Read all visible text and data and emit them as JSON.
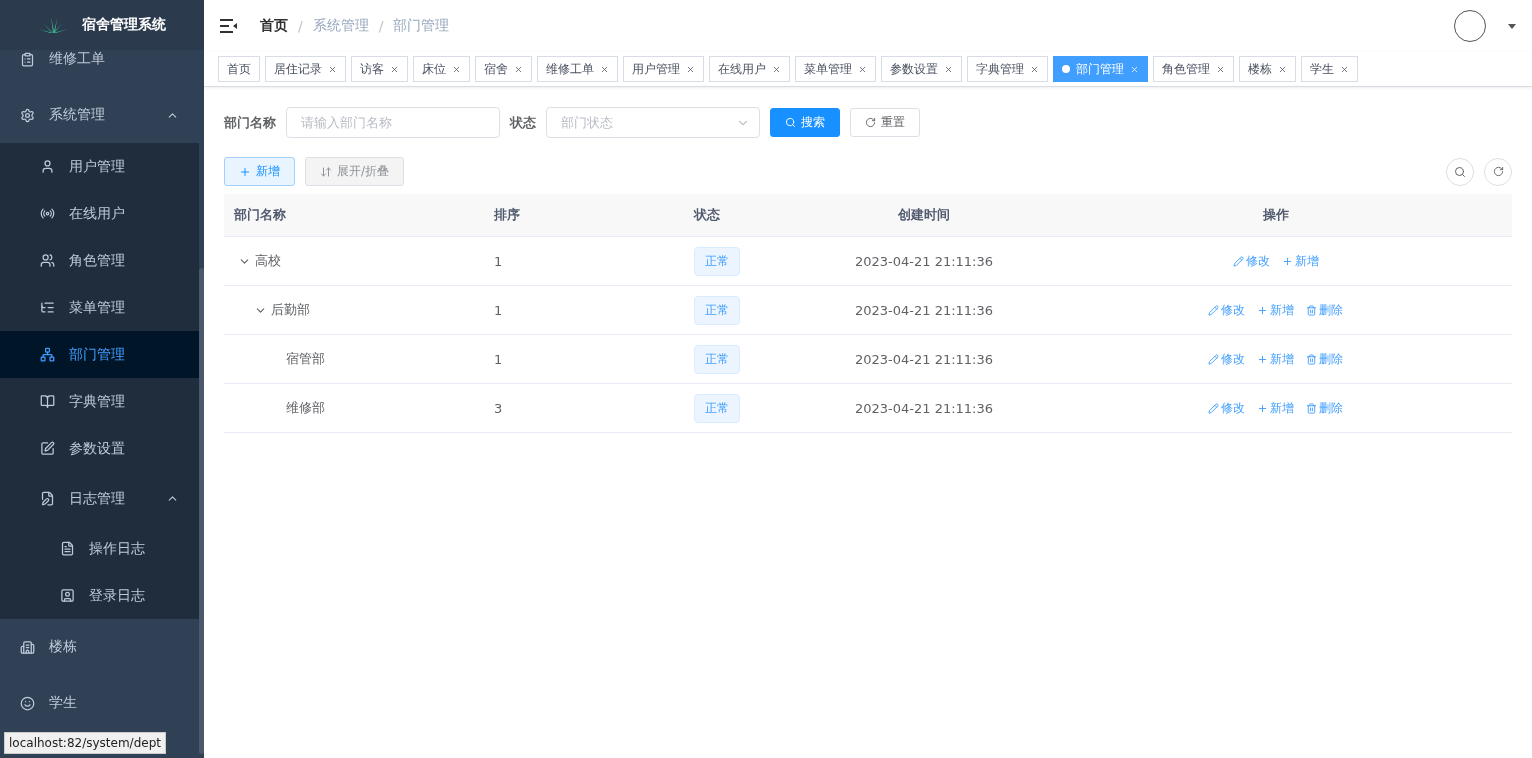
{
  "sidebar": {
    "logo_text": "宿舍管理系统",
    "items": [
      {
        "label": "维修工单",
        "selected": false
      },
      {
        "label": "系统管理",
        "selected": false,
        "expanded": true,
        "children": [
          {
            "label": "用户管理",
            "selected": false
          },
          {
            "label": "在线用户",
            "selected": false
          },
          {
            "label": "角色管理",
            "selected": false
          },
          {
            "label": "菜单管理",
            "selected": false
          },
          {
            "label": "部门管理",
            "selected": true
          },
          {
            "label": "字典管理",
            "selected": false
          },
          {
            "label": "参数设置",
            "selected": false
          },
          {
            "label": "日志管理",
            "selected": false,
            "expanded": true,
            "children": [
              {
                "label": "操作日志",
                "selected": false
              },
              {
                "label": "登录日志",
                "selected": false
              }
            ]
          }
        ]
      },
      {
        "label": "楼栋",
        "selected": false
      },
      {
        "label": "学生",
        "selected": false
      }
    ]
  },
  "breadcrumb": {
    "separator": "/",
    "items": [
      "首页",
      "系统管理",
      "部门管理"
    ]
  },
  "tags": [
    {
      "label": "首页",
      "selected": false,
      "closable": false
    },
    {
      "label": "居住记录",
      "selected": false,
      "closable": true
    },
    {
      "label": "访客",
      "selected": false,
      "closable": true
    },
    {
      "label": "床位",
      "selected": false,
      "closable": true
    },
    {
      "label": "宿舍",
      "selected": false,
      "closable": true
    },
    {
      "label": "维修工单",
      "selected": false,
      "closable": true
    },
    {
      "label": "用户管理",
      "selected": false,
      "closable": true
    },
    {
      "label": "在线用户",
      "selected": false,
      "closable": true
    },
    {
      "label": "菜单管理",
      "selected": false,
      "closable": true
    },
    {
      "label": "参数设置",
      "selected": false,
      "closable": true
    },
    {
      "label": "字典管理",
      "selected": false,
      "closable": true
    },
    {
      "label": "部门管理",
      "selected": true,
      "closable": true
    },
    {
      "label": "角色管理",
      "selected": false,
      "closable": true
    },
    {
      "label": "楼栋",
      "selected": false,
      "closable": true
    },
    {
      "label": "学生",
      "selected": false,
      "closable": true
    }
  ],
  "search": {
    "fields": [
      {
        "kind": "input",
        "label": "部门名称",
        "placeholder": "请输入部门名称"
      },
      {
        "kind": "select",
        "label": "状态",
        "placeholder": "部门状态"
      }
    ],
    "buttons": [
      {
        "kind": "primary",
        "label": "搜索"
      },
      {
        "kind": "default",
        "label": "重置"
      }
    ]
  },
  "toolbar": [
    {
      "kind": "add",
      "label": "新增"
    },
    {
      "kind": "toggle",
      "label": "展开/折叠"
    }
  ],
  "table": {
    "columns": [
      "部门名称",
      "排序",
      "状态",
      "创建时间",
      "操作"
    ],
    "rows": [
      {
        "name": "高校",
        "order": "1",
        "status": "正常",
        "created": "2023-04-21 21:11:36",
        "expanded": true,
        "actions": [
          {
            "kind": "edit",
            "label": "修改"
          },
          {
            "kind": "add",
            "label": "新增"
          }
        ],
        "children": [
          {
            "name": "后勤部",
            "order": "1",
            "status": "正常",
            "created": "2023-04-21 21:11:36",
            "expanded": true,
            "actions": [
              {
                "kind": "edit",
                "label": "修改"
              },
              {
                "kind": "add",
                "label": "新增"
              },
              {
                "kind": "delete",
                "label": "删除"
              }
            ],
            "children": [
              {
                "name": "宿管部",
                "order": "1",
                "status": "正常",
                "created": "2023-04-21 21:11:36",
                "actions": [
                  {
                    "kind": "edit",
                    "label": "修改"
                  },
                  {
                    "kind": "add",
                    "label": "新增"
                  },
                  {
                    "kind": "delete",
                    "label": "删除"
                  }
                ]
              },
              {
                "name": "维修部",
                "order": "3",
                "status": "正常",
                "created": "2023-04-21 21:11:36",
                "actions": [
                  {
                    "kind": "edit",
                    "label": "修改"
                  },
                  {
                    "kind": "add",
                    "label": "新增"
                  },
                  {
                    "kind": "delete",
                    "label": "删除"
                  }
                ]
              }
            ]
          }
        ]
      }
    ]
  },
  "status_url": "localhost:82/system/dept"
}
